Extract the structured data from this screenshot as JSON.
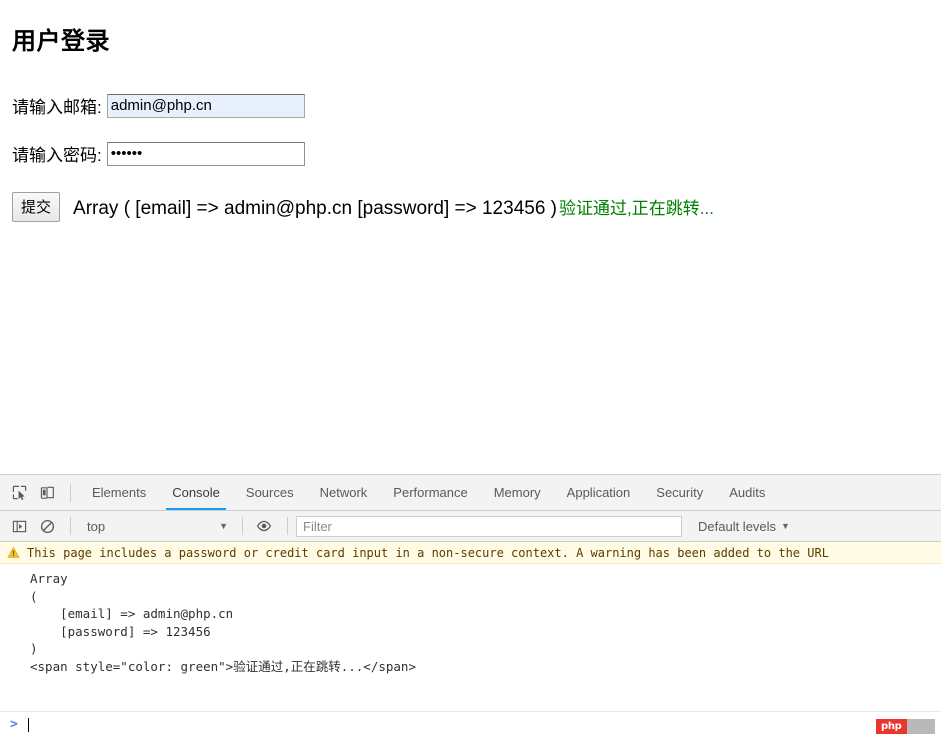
{
  "page": {
    "title": "用户登录",
    "email_label": "请输入邮箱:",
    "email_value": "admin@php.cn",
    "email_placeholder": "",
    "password_label": "请输入密码:",
    "password_value": "••••••",
    "password_placeholder": "",
    "submit_label": "提交",
    "dump_text": "Array ( [email] => admin@php.cn [password] => 123456 )",
    "success_message": "验证通过,正在跳转...",
    "success_color": "#008000"
  },
  "devtools": {
    "icons": {
      "inspect": "inspect-element-icon",
      "device": "device-toolbar-icon",
      "sidebar": "console-sidebar-icon",
      "clear": "clear-console-icon",
      "eye": "live-expression-icon"
    },
    "tabs": [
      {
        "label": "Elements",
        "active": false
      },
      {
        "label": "Console",
        "active": true
      },
      {
        "label": "Sources",
        "active": false
      },
      {
        "label": "Network",
        "active": false
      },
      {
        "label": "Performance",
        "active": false
      },
      {
        "label": "Memory",
        "active": false
      },
      {
        "label": "Application",
        "active": false
      },
      {
        "label": "Security",
        "active": false
      },
      {
        "label": "Audits",
        "active": false
      }
    ],
    "active_tab_underline_color": "#1a9cf0",
    "context_selector": "top",
    "filter_placeholder": "Filter",
    "filter_value": "",
    "levels_selector": "Default levels",
    "console": {
      "warning": "This page includes a password or credit card input in a non-secure context. A warning has been added to the URL",
      "warning_bg": "#fffbe5",
      "output": "Array\n(\n    [email] => admin@php.cn\n    [password] => 123456\n)\n<span style=\"color: green\">验证通过,正在跳转...</span>",
      "prompt_symbol": ">"
    }
  },
  "badge": {
    "text": "php",
    "red": "#e8362c",
    "grey": "#b9b9b9"
  }
}
